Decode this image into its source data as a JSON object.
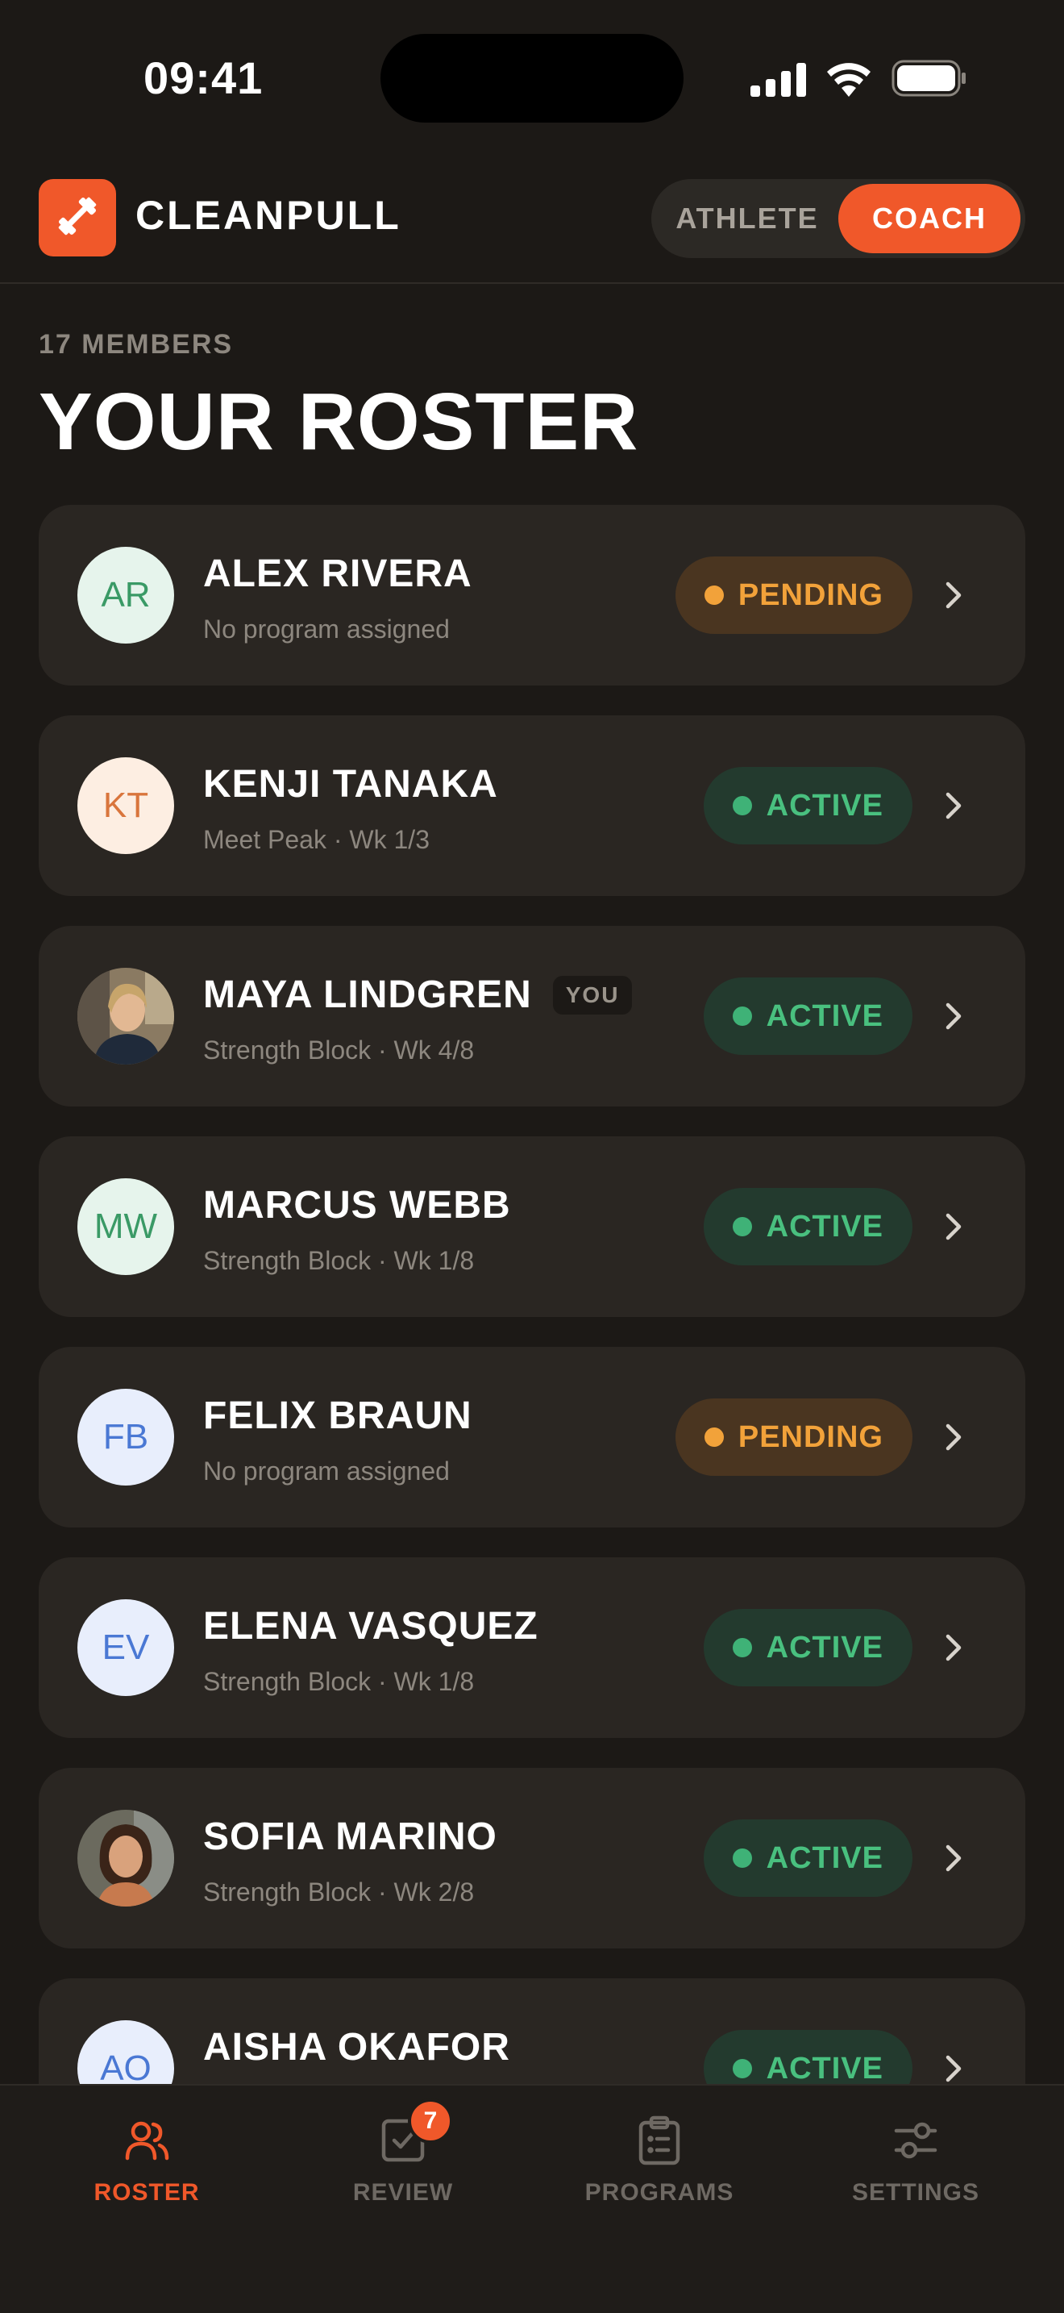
{
  "status_bar": {
    "time": "09:41"
  },
  "header": {
    "brand": "CLEANPULL",
    "logo_icon": "dumbbell-icon",
    "roles": [
      {
        "label": "ATHLETE",
        "active": false
      },
      {
        "label": "COACH",
        "active": true
      }
    ]
  },
  "page": {
    "members_count": "17 MEMBERS",
    "title": "YOUR ROSTER"
  },
  "colors": {
    "accent": "#f0582a",
    "active_status": "#49c07f",
    "pending_status": "#f2a23a",
    "background": "#1c1916",
    "card": "#2a2622"
  },
  "roster": [
    {
      "initials": "AR",
      "avatar_style": "green",
      "name": "ALEX RIVERA",
      "program": "No program assigned",
      "status": "PENDING",
      "you": ""
    },
    {
      "initials": "KT",
      "avatar_style": "orange",
      "name": "KENJI TANAKA",
      "program": "Meet Peak · Wk 1/3",
      "status": "ACTIVE",
      "you": ""
    },
    {
      "initials": "",
      "avatar_style": "photo1",
      "name": "MAYA LINDGREN",
      "program": "Strength Block · Wk 4/8",
      "status": "ACTIVE",
      "you": "YOU"
    },
    {
      "initials": "MW",
      "avatar_style": "green",
      "name": "MARCUS WEBB",
      "program": "Strength Block · Wk 1/8",
      "status": "ACTIVE",
      "you": ""
    },
    {
      "initials": "FB",
      "avatar_style": "blue",
      "name": "FELIX BRAUN",
      "program": "No program assigned",
      "status": "PENDING",
      "you": ""
    },
    {
      "initials": "EV",
      "avatar_style": "blue",
      "name": "ELENA VASQUEZ",
      "program": "Strength Block · Wk 1/8",
      "status": "ACTIVE",
      "you": ""
    },
    {
      "initials": "",
      "avatar_style": "photo2",
      "name": "SOFIA MARINO",
      "program": "Strength Block · Wk 2/8",
      "status": "ACTIVE",
      "you": ""
    },
    {
      "initials": "AO",
      "avatar_style": "blue",
      "name": "AISHA OKAFOR",
      "program": "",
      "status": "ACTIVE",
      "you": ""
    }
  ],
  "tab_bar": {
    "tabs": [
      {
        "label": "ROSTER",
        "icon": "people-icon",
        "active": true,
        "badge": ""
      },
      {
        "label": "REVIEW",
        "icon": "checkbox-icon",
        "active": false,
        "badge": "7"
      },
      {
        "label": "PROGRAMS",
        "icon": "clipboard-icon",
        "active": false,
        "badge": ""
      },
      {
        "label": "SETTINGS",
        "icon": "sliders-icon",
        "active": false,
        "badge": ""
      }
    ]
  }
}
